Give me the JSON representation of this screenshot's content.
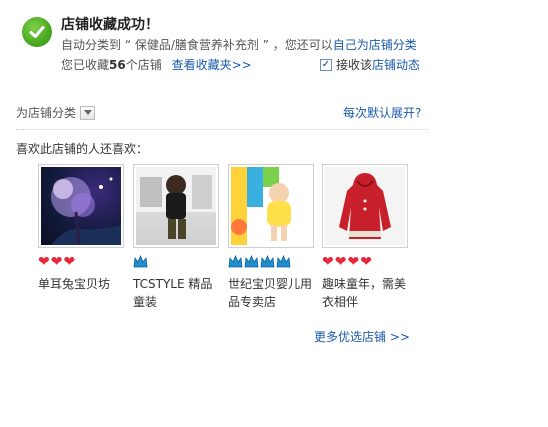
{
  "header": {
    "title": "店铺收藏成功！",
    "category_prefix": "自动分类到 “ 保健品/膳食营养补充剂 ” ，您还可以",
    "category_link": "自己为店铺分类",
    "count_prefix": "您已收藏",
    "count_value": "56",
    "count_suffix": "个店铺",
    "view_favorites_link": "查看收藏夹>>",
    "subscribe_label": "接收该",
    "subscribe_link": "店铺动态",
    "subscribe_checked": true
  },
  "category": {
    "label": "为店铺分类",
    "expand_link": "每次默认展开?"
  },
  "recommend": {
    "heading": "喜欢此店铺的人还喜欢：",
    "shops": [
      {
        "name": "单耳兔宝贝坊",
        "rating_icon": "heart",
        "rating_count": 3
      },
      {
        "name": "TCSTYLE 精品童装",
        "rating_icon": "crown",
        "rating_count": 1
      },
      {
        "name": "世纪宝贝婴儿用品专卖店",
        "rating_icon": "crown",
        "rating_count": 4
      },
      {
        "name": "趣味童年，需美衣相伴",
        "rating_icon": "heart",
        "rating_count": 4
      }
    ],
    "more_link": "更多优选店铺 >>"
  },
  "colors": {
    "link": "#1a5aa8",
    "success_green": "#4aa821",
    "heart_red": "#e8283a",
    "crown_blue": "#1f8fd0"
  }
}
